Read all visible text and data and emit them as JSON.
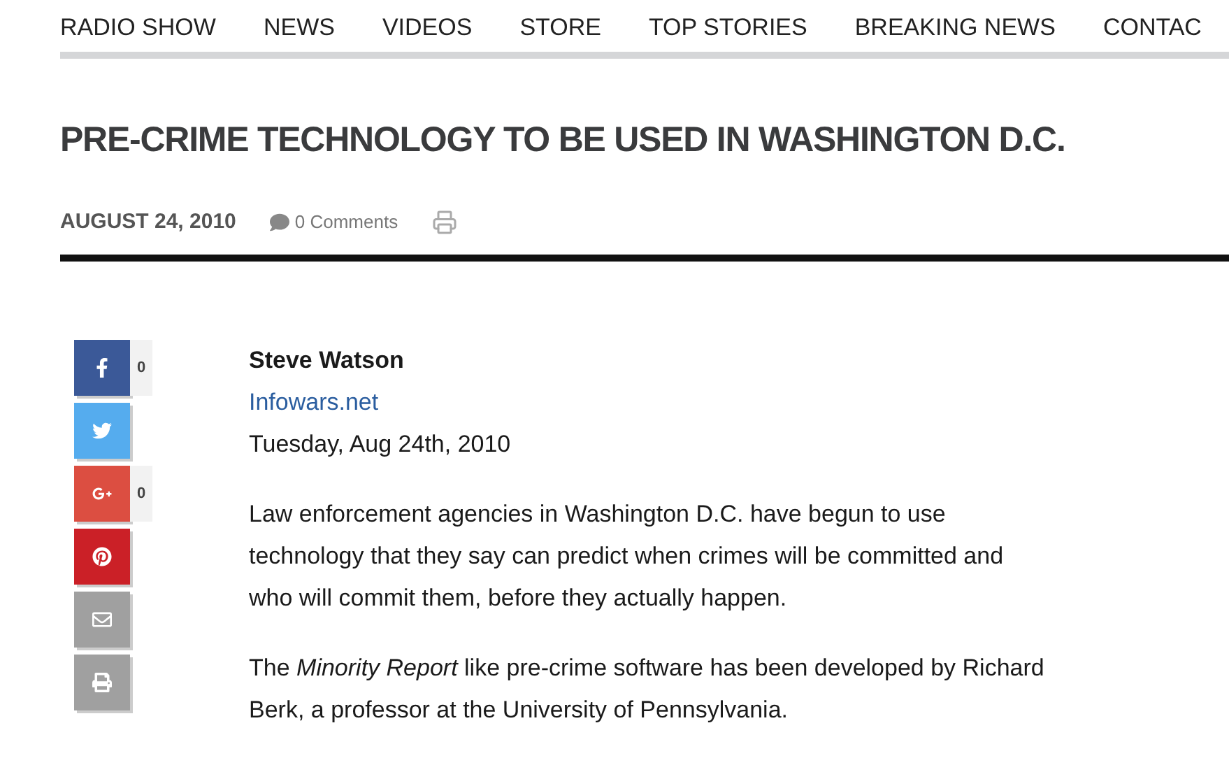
{
  "nav": [
    "RADIO SHOW",
    "NEWS",
    "VIDEOS",
    "STORE",
    "TOP STORIES",
    "BREAKING NEWS",
    "CONTAC"
  ],
  "title": "PRE-CRIME TECHNOLOGY TO BE USED IN WASHINGTON D.C.",
  "meta": {
    "date": "AUGUST 24, 2010",
    "comments": "0 Comments"
  },
  "share": [
    {
      "kind": "facebook",
      "count": "0"
    },
    {
      "kind": "twitter"
    },
    {
      "kind": "googleplus",
      "count": "0"
    },
    {
      "kind": "pinterest"
    },
    {
      "kind": "email"
    },
    {
      "kind": "print"
    }
  ],
  "article": {
    "author": "Steve Watson",
    "source": "Infowars.net",
    "dateline": "Tuesday, Aug 24th, 2010",
    "paragraphs": [
      "Law enforcement agencies in Washington D.C. have begun to use technology that they say can predict when crimes will be committed and who will commit them, before they actually happen.",
      "The *Minority Report* like pre-crime software has been developed by Richard Berk, a professor at the University of Pennsylvania."
    ]
  }
}
